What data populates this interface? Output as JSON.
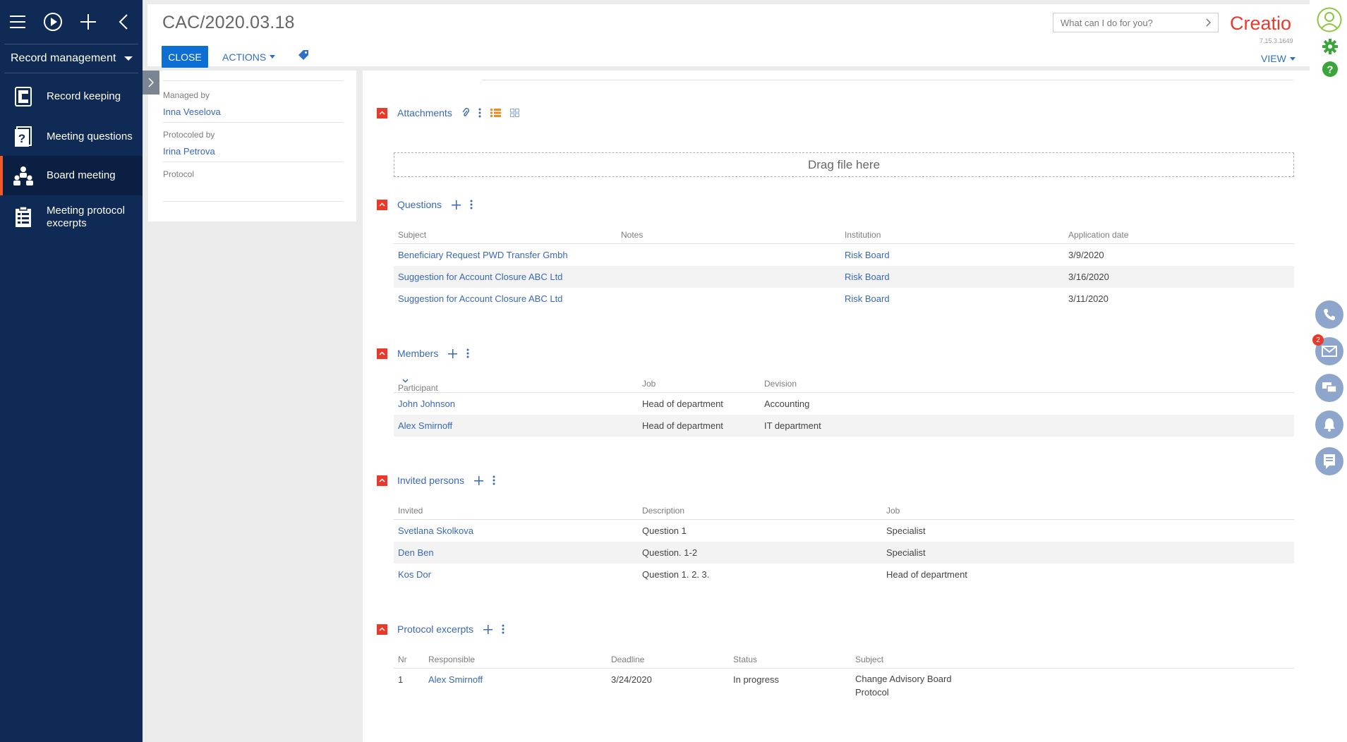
{
  "sidebar": {
    "workplace": "Record management",
    "items": [
      {
        "label": "Record keeping",
        "icon": "record-keeping-icon"
      },
      {
        "label": "Meeting questions",
        "icon": "meeting-questions-icon"
      },
      {
        "label": "Board meeting",
        "icon": "board-meeting-icon",
        "active": true
      },
      {
        "label": "Meeting protocol excerpts",
        "icon": "protocol-excerpts-icon"
      }
    ]
  },
  "header": {
    "title": "CAC/2020.03.18",
    "close_label": "CLOSE",
    "actions_label": "ACTIONS",
    "command_placeholder": "What can I do for you?",
    "logo": "Creatio",
    "version": "7.15.3.1649",
    "view_label": "VIEW"
  },
  "left_panel": {
    "managed_by_label": "Managed by",
    "managed_by_value": "Inna Veselova",
    "protocoled_by_label": "Protocoled by",
    "protocoled_by_value": "Irina Petrova",
    "protocol_label": "Protocol",
    "protocol_value": ""
  },
  "attachments": {
    "title": "Attachments",
    "dropzone": "Drag file here"
  },
  "questions": {
    "title": "Questions",
    "columns": [
      "Subject",
      "Notes",
      "Institution",
      "Application date"
    ],
    "rows": [
      {
        "subject": "Beneficiary Request PWD Transfer Gmbh",
        "notes": "",
        "institution": "Risk Board",
        "date": "3/9/2020"
      },
      {
        "subject": "Suggestion for Account Closure ABC Ltd",
        "notes": "",
        "institution": "Risk Board",
        "date": "3/16/2020"
      },
      {
        "subject": "Suggestion for Account Closure ABC Ltd",
        "notes": "",
        "institution": "Risk Board",
        "date": "3/11/2020"
      }
    ]
  },
  "members": {
    "title": "Members",
    "columns": [
      "Participant",
      "Job",
      "Devision"
    ],
    "rows": [
      {
        "participant": "John Johnson",
        "job": "Head of department",
        "division": "Accounting"
      },
      {
        "participant": "Alex Smirnoff",
        "job": "Head of department",
        "division": "IT department"
      }
    ]
  },
  "invited": {
    "title": "Invited persons",
    "columns": [
      "Invited",
      "Description",
      "Job"
    ],
    "rows": [
      {
        "invited": "Svetlana Skolkova",
        "description": "Question 1",
        "job": "Specialist"
      },
      {
        "invited": "Den Ben",
        "description": "Question. 1-2",
        "job": "Specialist"
      },
      {
        "invited": "Kos Dor",
        "description": "Question 1. 2. 3.",
        "job": "Head of department"
      }
    ]
  },
  "excerpts": {
    "title": "Protocol excerpts",
    "columns": [
      "Nr",
      "Responsible",
      "Deadline",
      "Status",
      "Subject"
    ],
    "rows": [
      {
        "nr": "1",
        "responsible": "Alex Smirnoff",
        "deadline": "3/24/2020",
        "status": "In progress",
        "subject_line1": "Change Advisory Board",
        "subject_line2": "Protocol"
      }
    ]
  },
  "rightbar": {
    "email_badge": "2"
  },
  "colors": {
    "sidebar": "#0f2a54",
    "accent": "#e8392a",
    "link": "#3a68b8",
    "primary_button": "#0d6ed4"
  }
}
